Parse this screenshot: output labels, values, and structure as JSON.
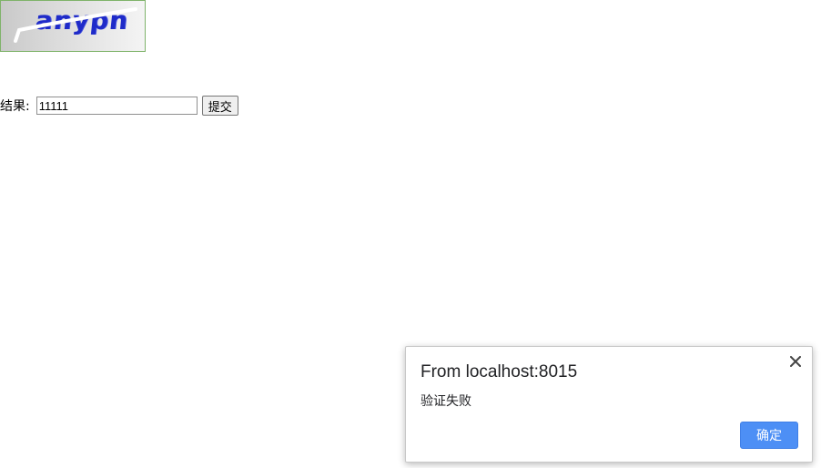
{
  "captcha": {
    "text": "anypn"
  },
  "form": {
    "label": "结果:",
    "input_value": "11111",
    "submit_label": "提交"
  },
  "dialog": {
    "origin": "From localhost:8015",
    "message": "验证失败",
    "ok_label": "确定",
    "close_icon": "close-icon"
  },
  "colors": {
    "ok_button": "#4d8ff5",
    "captcha_text": "#1f2bc9",
    "captcha_border": "#7fb36a"
  }
}
